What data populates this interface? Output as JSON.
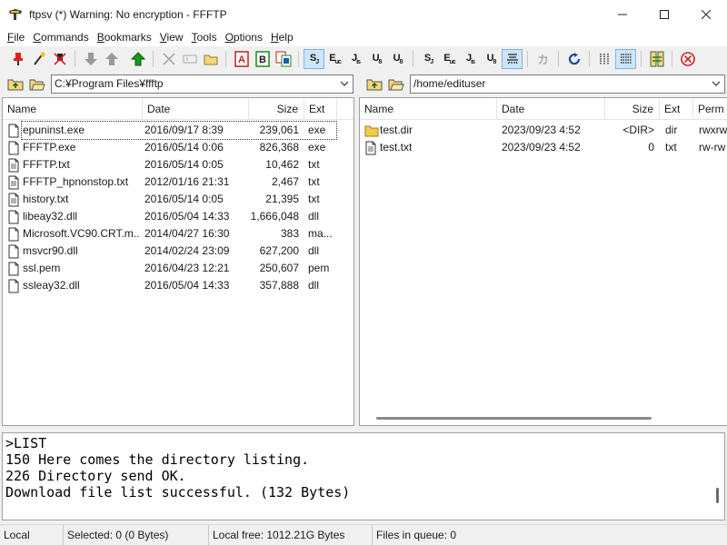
{
  "window": {
    "title": "ftpsv (*) Warning: No encryption - FFFTP"
  },
  "menu": [
    {
      "label": "File",
      "accel": "F",
      "rest": "ile"
    },
    {
      "label": "Commands",
      "accel": "C",
      "rest": "ommands"
    },
    {
      "label": "Bookmarks",
      "accel": "B",
      "rest": "ookmarks"
    },
    {
      "label": "View",
      "accel": "V",
      "rest": "iew"
    },
    {
      "label": "Tools",
      "accel": "T",
      "rest": "ools"
    },
    {
      "label": "Options",
      "accel": "O",
      "rest": "ptions"
    },
    {
      "label": "Help",
      "accel": "H",
      "rest": "elp"
    }
  ],
  "toolbar": {
    "kanji_jis": "S",
    "kanji_euc": "E",
    "kanji_jis2": "J",
    "kanji_utf8": "U",
    "kanji_utf8b": "U",
    "kana": "カ",
    "ascii_A": "A",
    "binary_B": "B",
    "icons": [
      "connect-icon",
      "quick-connect-icon",
      "disconnect-icon",
      "download-icon",
      "upload-icon",
      "mirror-upload-icon",
      "delete-icon",
      "rename-icon",
      "mkdir-icon",
      "ascii-mode-icon",
      "binary-mode-icon",
      "auto-mode-icon",
      "sjis-icon",
      "euc-icon",
      "jis-icon",
      "utf8-icon",
      "utf8bom-icon",
      "remote-sjis-icon",
      "remote-euc-icon",
      "remote-jis-icon",
      "remote-utf8-icon",
      "remote-utf8bom-icon",
      "no-convert-icon",
      "kana-icon",
      "refresh-icon",
      "list-view-icon",
      "detail-view-icon",
      "sync-browse-icon",
      "abort-icon"
    ]
  },
  "local": {
    "path": "C:¥Program Files¥ffftp",
    "headers": {
      "name": "Name",
      "date": "Date",
      "size": "Size",
      "ext": "Ext"
    },
    "files": [
      {
        "name": "epuninst.exe",
        "date": "2016/09/17  8:39",
        "size": "239,061",
        "ext": "exe"
      },
      {
        "name": "FFFTP.exe",
        "date": "2016/05/14  0:06",
        "size": "826,368",
        "ext": "exe"
      },
      {
        "name": "FFFTP.txt",
        "date": "2016/05/14  0:05",
        "size": "10,462",
        "ext": "txt"
      },
      {
        "name": "FFFTP_hpnonstop.txt",
        "date": "2012/01/16 21:31",
        "size": "2,467",
        "ext": "txt"
      },
      {
        "name": "history.txt",
        "date": "2016/05/14  0:05",
        "size": "21,395",
        "ext": "txt"
      },
      {
        "name": "libeay32.dll",
        "date": "2016/05/04 14:33",
        "size": "1,666,048",
        "ext": "dll"
      },
      {
        "name": "Microsoft.VC90.CRT.m...",
        "date": "2014/04/27 16:30",
        "size": "383",
        "ext": "ma..."
      },
      {
        "name": "msvcr90.dll",
        "date": "2014/02/24 23:09",
        "size": "627,200",
        "ext": "dll"
      },
      {
        "name": "ssl.pem",
        "date": "2016/04/23 12:21",
        "size": "250,607",
        "ext": "pem"
      },
      {
        "name": "ssleay32.dll",
        "date": "2016/05/04 14:33",
        "size": "357,888",
        "ext": "dll"
      }
    ]
  },
  "remote": {
    "path": "/home/edituser",
    "headers": {
      "name": "Name",
      "date": "Date",
      "size": "Size",
      "ext": "Ext",
      "perm": "Perm"
    },
    "files": [
      {
        "name": "test.dir",
        "date": "2023/09/23  4:52",
        "size": "<DIR>",
        "ext": "dir",
        "perm": "rwxrw",
        "type": "folder"
      },
      {
        "name": "test.txt",
        "date": "2023/09/23  4:52",
        "size": "0",
        "ext": "txt",
        "perm": "rw-rw",
        "type": "file"
      }
    ]
  },
  "log": [
    ">LIST",
    "150 Here comes the directory listing.",
    "226 Directory send OK.",
    "Download file list successful. (132 Bytes)"
  ],
  "status": {
    "mode": "Local",
    "selected": "Selected: 0 (0 Bytes)",
    "free": "Local free: 1012.21G Bytes",
    "queue": "Files in queue: 0"
  }
}
